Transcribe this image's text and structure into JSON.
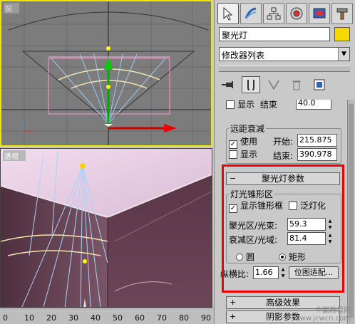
{
  "viewports": {
    "front_label": "前",
    "persp_label": "透视"
  },
  "ruler": {
    "ticks": [
      "0",
      "10",
      "20",
      "30",
      "40",
      "50",
      "60",
      "70",
      "80",
      "90"
    ]
  },
  "panel": {
    "tabs": [
      {
        "name": "create-icon",
        "active": true
      },
      {
        "name": "modify-icon",
        "active": false
      },
      {
        "name": "hierarchy-icon",
        "active": false
      },
      {
        "name": "motion-icon",
        "active": false
      },
      {
        "name": "display-icon",
        "active": false
      },
      {
        "name": "utilities-icon",
        "active": false
      }
    ],
    "object_name": "聚光灯",
    "color": "#f5d800",
    "modifier_list": "修改器列表",
    "far_atten": {
      "top_partial_show": "显示",
      "top_partial_end": "结束",
      "top_partial_value": "40.0",
      "title": "远距衰减",
      "use_label": "使用",
      "use_checked": true,
      "show_label": "显示",
      "show_checked": false,
      "start_label": "开始:",
      "start_value": "215.875",
      "end_label": "结束:",
      "end_value": "390.978"
    },
    "spot_params": {
      "rollout_title": "聚光灯参数",
      "group_title": "灯光锥形区",
      "show_cone_label": "显示锥形框",
      "show_cone_checked": true,
      "overshoot_label": "泛灯化",
      "overshoot_checked": false,
      "hotspot_label": "聚光区/光束:",
      "hotspot_value": "59.3",
      "falloff_label": "衰减区/光域:",
      "falloff_value": "81.4",
      "circle_label": "圆",
      "rect_label": "矩形",
      "shape": "rectangle",
      "aspect_label": "纵横比:",
      "aspect_value": "1.66",
      "bitmap_fit_label": "位图适配..."
    },
    "advanced_effects": "高级效果",
    "shadow_params": "阴影参数"
  },
  "watermark": {
    "line1": "中国教程网",
    "line2": "www.jcwcn.com"
  }
}
